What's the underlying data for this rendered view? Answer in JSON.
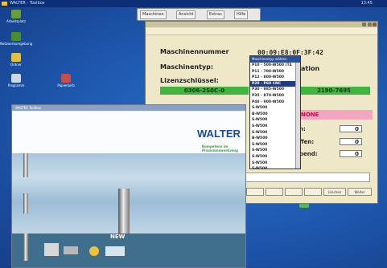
{
  "taskbar": {
    "title": "WALTER - Toolbox",
    "clock": "13:45"
  },
  "desktop_icons": [
    {
      "label": "Arbeitsplatz"
    },
    {
      "label": "Netzwerkumgebung"
    },
    {
      "label": "Ordner"
    },
    {
      "label": "Programm"
    },
    {
      "label": "Papierkorb"
    }
  ],
  "toolbar": {
    "buttons": [
      {
        "label": "Maschinen"
      },
      {
        "label": "Ansicht"
      },
      {
        "label": "Extras"
      },
      {
        "label": "Hilfe"
      }
    ]
  },
  "machine_window": {
    "labels": {
      "machine_number": "Maschinennummer",
      "machine_type": "Maschinentyp:",
      "license_key": "Lizenzschlüssel:",
      "ation": "ation"
    },
    "values": {
      "machine_number": "00:09:E8:0F:3F:42",
      "green_left": "0306-2S0C-0",
      "green_right": "2190-7695"
    },
    "status_banner": "NONE",
    "stats": [
      {
        "label": "n:",
        "value": "0"
      },
      {
        "label": "ffen:",
        "value": "0"
      },
      {
        "label": "bend:",
        "value": "0"
      }
    ],
    "button_row": [
      {
        "label": ""
      },
      {
        "label": ""
      },
      {
        "label": ""
      },
      {
        "label": ""
      },
      {
        "label": "Löschen"
      },
      {
        "label": "Weiter"
      }
    ]
  },
  "dropdown": {
    "header": "Maschinentyp wählen",
    "items": [
      {
        "label": "P10 - 500-W500 (T4"
      },
      {
        "label": "P11 - 700-W500"
      },
      {
        "label": "P12 - 800-W500"
      },
      {
        "label": "P20 - P60 CNC",
        "selected": true
      },
      {
        "label": "P30 - 985-W500"
      },
      {
        "label": "P35 - 870-W500"
      },
      {
        "label": "P40 - 900-W500"
      },
      {
        "label": "S-W500"
      },
      {
        "label": "B-W500"
      },
      {
        "label": "S-W500"
      },
      {
        "label": "S-W500"
      },
      {
        "label": "S-W500"
      },
      {
        "label": "B-W500"
      },
      {
        "label": "S-W500"
      },
      {
        "label": "S-W500"
      },
      {
        "label": "S-W500"
      },
      {
        "label": "S-W500"
      },
      {
        "label": "S-W500"
      }
    ]
  },
  "walter_window": {
    "title": "WALTER Toolbox",
    "brand": "WALTER",
    "tagline": "Kompetenz im Präzisionswerkzeug",
    "new_badge": "NEW"
  },
  "colors": {
    "desktop": "#1f5bb4",
    "green": "#3fb43f",
    "pink": "#f3a6c0",
    "selection": "#1a3c8a"
  }
}
